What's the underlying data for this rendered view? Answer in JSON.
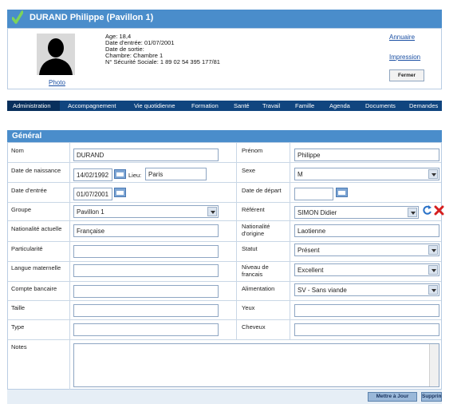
{
  "header": {
    "title": "DURAND Philippe (Pavillon 1)"
  },
  "info": {
    "age": "Age: 18,4",
    "entree": "Date d'entrée: 01/07/2001",
    "sortie": "Date de sortie:",
    "chambre": "Chambre: Chambre 1",
    "secu": "N° Sécurité Sociale: 1 89 02 54 395 177/81",
    "photo_link": "Photo"
  },
  "actions": {
    "annuaire": "Annuaire",
    "impression": "Impression",
    "fermer": "Fermer"
  },
  "nav": [
    "Administration",
    "Accompagnement",
    "Vie quotidienne",
    "Formation",
    "Santé",
    "Travail",
    "Famille",
    "Agenda",
    "Documents",
    "Demandes"
  ],
  "section": {
    "title": "Général"
  },
  "fields": {
    "nom": {
      "label": "Nom",
      "value": "DURAND"
    },
    "prenom": {
      "label": "Prénom",
      "value": "Philippe"
    },
    "naissance": {
      "label": "Date de naissance",
      "value": "14/02/1992",
      "lieu_label": "Lieu:",
      "lieu": "Paris"
    },
    "sexe": {
      "label": "Sexe",
      "value": "M"
    },
    "entree": {
      "label": "Date d'entrée",
      "value": "01/07/2001"
    },
    "depart": {
      "label": "Date de départ",
      "value": ""
    },
    "groupe": {
      "label": "Groupe",
      "value": "Pavillon 1"
    },
    "referent": {
      "label": "Référent",
      "value": "SIMON Didier"
    },
    "nat_actuelle": {
      "label": "Nationalité actuelle",
      "value": "Française"
    },
    "nat_origine": {
      "label1": "Nationalité",
      "label2": "d'origine",
      "value": "Laotienne"
    },
    "particularite": {
      "label": "Particularité",
      "value": ""
    },
    "statut": {
      "label": "Statut",
      "value": "Présent"
    },
    "langue": {
      "label": "Langue maternelle",
      "value": ""
    },
    "niveau": {
      "label1": "Niveau de",
      "label2": "francais",
      "value": "Excellent"
    },
    "compte": {
      "label": "Compte bancaire",
      "value": ""
    },
    "alimentation": {
      "label": "Alimentation",
      "value": "SV - Sans viande"
    },
    "taille": {
      "label": "Taille",
      "value": ""
    },
    "yeux": {
      "label": "Yeux",
      "value": ""
    },
    "type": {
      "label": "Type",
      "value": ""
    },
    "cheveux": {
      "label": "Cheveux",
      "value": ""
    },
    "notes": {
      "label": "Notes",
      "value": ""
    }
  },
  "footer": {
    "update": "Mettre à Jour",
    "delete": "Supprimer"
  }
}
